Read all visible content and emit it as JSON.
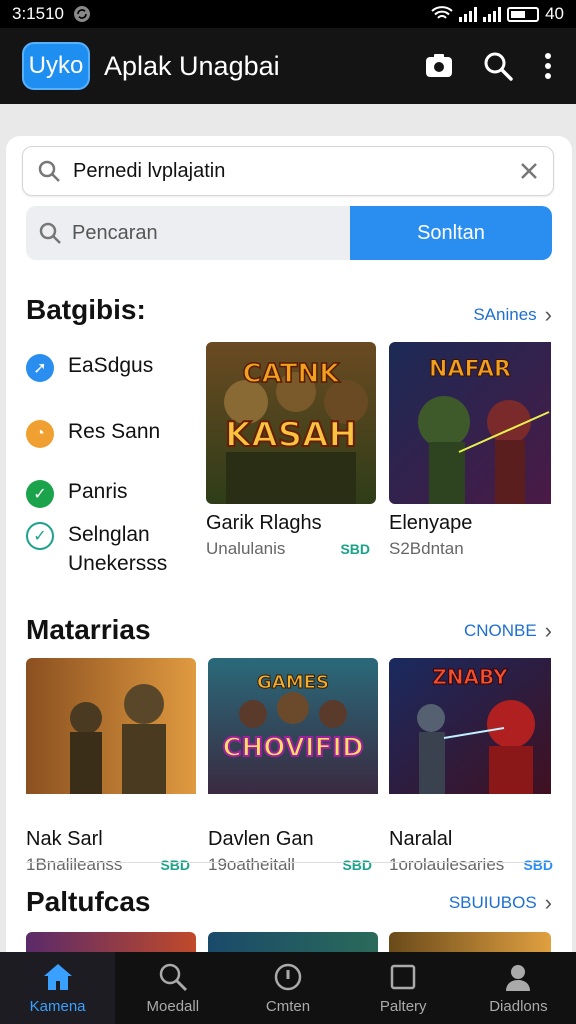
{
  "status": {
    "time": "3:1510",
    "battery": "40"
  },
  "app": {
    "logo_text": "Uyko",
    "title": "Aplak Unagbai",
    "icons": [
      "camera-icon",
      "search-icon",
      "more-vert-icon"
    ]
  },
  "search": {
    "query": "Pernedi lvplajatin",
    "placeholder": "Pencaran",
    "button_label": "Sonltan"
  },
  "section1": {
    "title": "Batgibis:",
    "link": "SAnines",
    "filters": [
      {
        "label": "EaSdgus",
        "color": "#2a8ef0",
        "icon": "send-icon"
      },
      {
        "label": "Res Sann",
        "color": "#f0a030",
        "icon": "clock-icon"
      },
      {
        "label": "Panris",
        "color": "#1aa34a",
        "icon": "check-icon"
      },
      {
        "label": "Selnglan Unekersss",
        "color": "#1aa38a",
        "icon": "check-outline-icon"
      }
    ],
    "games": [
      {
        "name": "Garik Rlaghs",
        "meta": "Unalulanis",
        "badge": "SBD",
        "art": "CATNK KASAH"
      },
      {
        "name": "Elenyape",
        "meta": "S2Bdntan",
        "badge": "",
        "art": "NAFAR"
      }
    ]
  },
  "section2": {
    "title": "Matarrias",
    "link": "CNONBE",
    "games": [
      {
        "name": "Nak Sarl",
        "meta": "1Bnalileanss",
        "badge": "SBD",
        "art": ""
      },
      {
        "name": "Davlen Gan",
        "meta": "19oatheitall",
        "badge": "SBD",
        "art": "CHOVIFID"
      },
      {
        "name": "Naralal",
        "meta": "1orolaulesaries",
        "badge": "SBD",
        "art": "ZNABY"
      }
    ]
  },
  "section3": {
    "title": "Paltufcas",
    "link": "SBUIUBOS"
  },
  "nav": [
    {
      "label": "Kamena",
      "icon": "home-icon",
      "active": true
    },
    {
      "label": "Moedall",
      "icon": "search-icon",
      "active": false
    },
    {
      "label": "Cmten",
      "icon": "info-icon",
      "active": false
    },
    {
      "label": "Paltery",
      "icon": "square-icon",
      "active": false
    },
    {
      "label": "Diadlons",
      "icon": "person-icon",
      "active": false
    }
  ]
}
